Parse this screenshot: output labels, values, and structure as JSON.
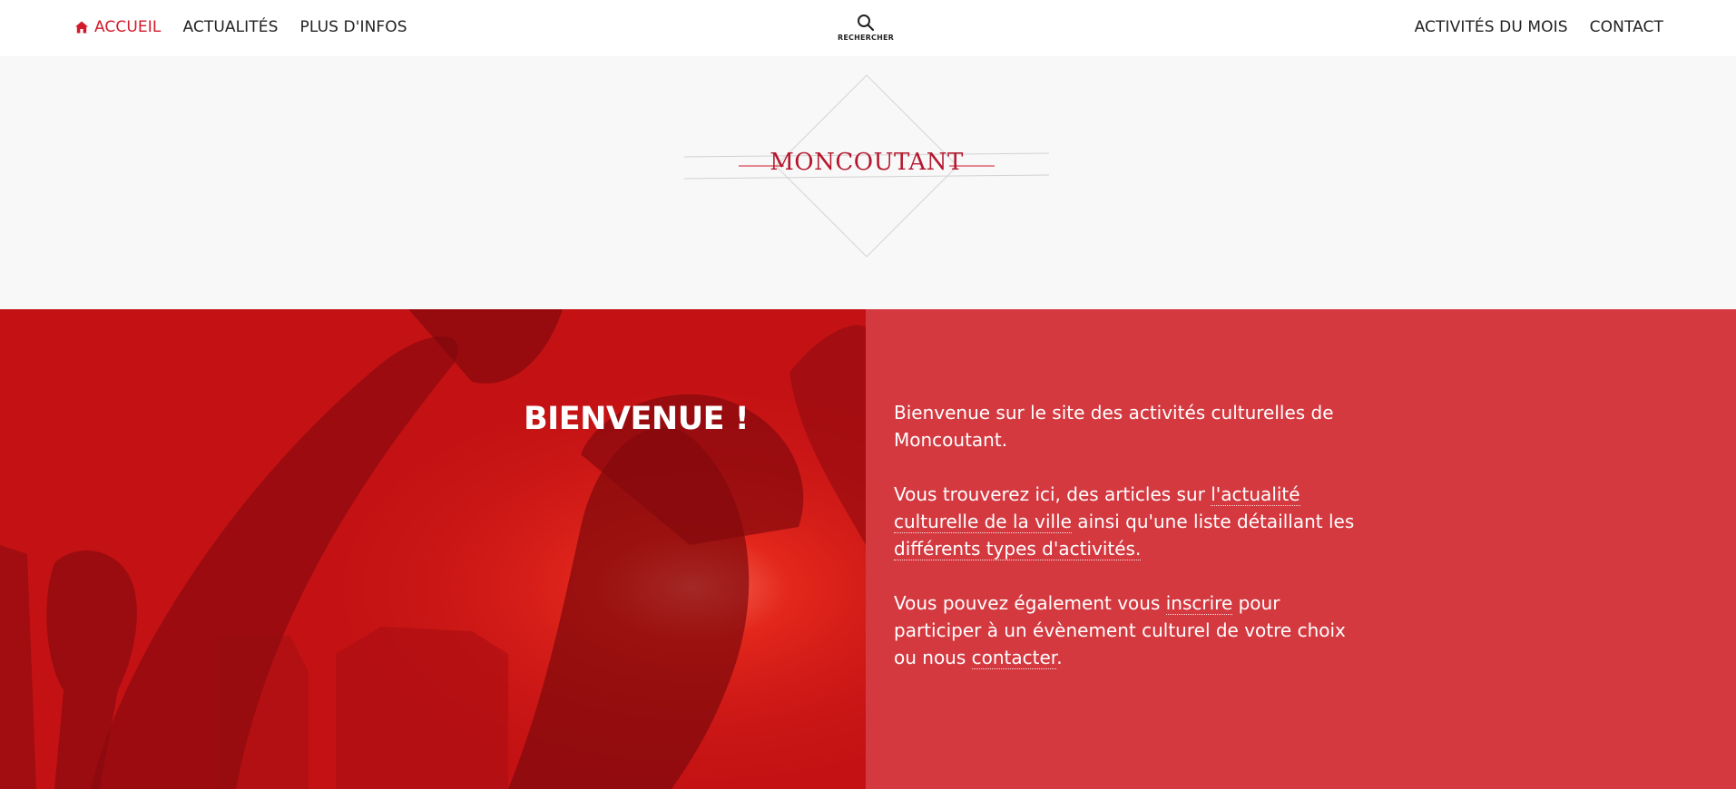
{
  "nav": {
    "home": "ACCUEIL",
    "news": "ACTUALITÉS",
    "more": "PLUS D'INFOS",
    "search": "RECHERCHER",
    "month": "ACTIVITÉS DU MOIS",
    "contact": "CONTACT"
  },
  "brand": "MONCOUTANT",
  "hero": {
    "title": "BIENVENUE !",
    "p1": "Bienvenue sur le site des activités culturelles de Moncoutant.",
    "p2_a": "Vous trouverez ici, des articles sur ",
    "p2_link1": "l'actualité culturelle de la ville",
    "p2_b": " ainsi qu'une liste détaillant les ",
    "p2_link2": "différents types d'activités.",
    "p3_a": "Vous pouvez également vous ",
    "p3_link1": "inscrire",
    "p3_b": " pour participer à un évènement culturel de votre choix ou nous ",
    "p3_link2": "contacter",
    "p3_c": "."
  },
  "colors": {
    "accent": "#d11a2a",
    "hero_left": "#c41214",
    "hero_right": "#d43940",
    "banner": "#f8f8f8"
  },
  "icons": {
    "home": "home-icon",
    "search": "search-icon"
  }
}
